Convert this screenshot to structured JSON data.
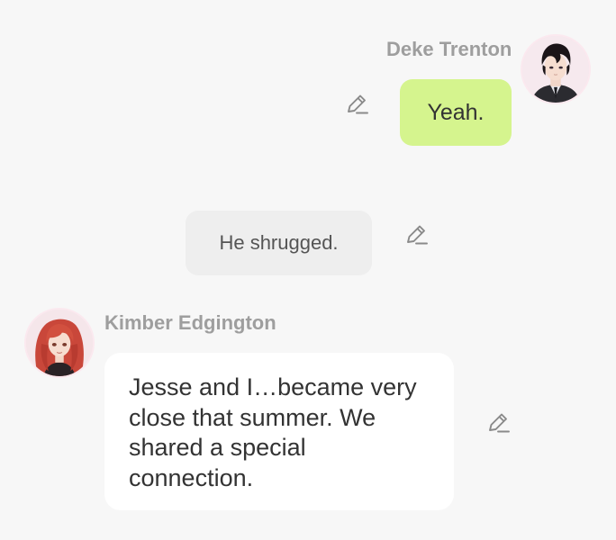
{
  "messages": [
    {
      "speaker": "Deke Trenton",
      "text": "Yeah.",
      "side": "right",
      "bubble_color": "#d5f48e",
      "avatar_icon": "dark-haired-man-avatar",
      "edit_icon": "pencil-icon"
    },
    {
      "speaker": "",
      "text": "He shrugged.",
      "side": "center",
      "bubble_color": "#eeeeee",
      "edit_icon": "pencil-icon"
    },
    {
      "speaker": "Kimber Edgington",
      "text": "Jesse and I…became very close that summer. We shared a special connection.",
      "side": "left",
      "bubble_color": "#ffffff",
      "avatar_icon": "red-haired-woman-avatar",
      "edit_icon": "pencil-icon"
    }
  ],
  "colors": {
    "background": "#f7f7f7",
    "name_text": "#9e9e9e",
    "message_text": "#333333",
    "icon": "#8a8a8a"
  }
}
